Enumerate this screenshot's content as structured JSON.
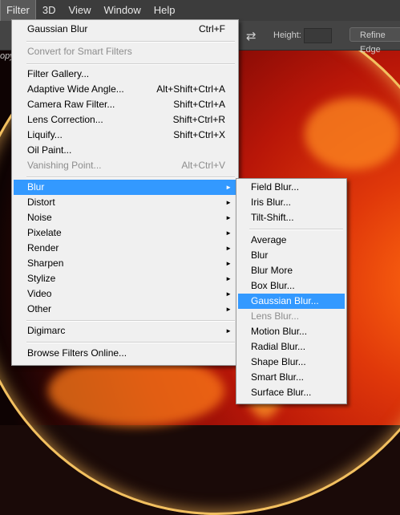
{
  "menubar": {
    "items": [
      {
        "label": "Filter",
        "active": true
      },
      {
        "label": "3D"
      },
      {
        "label": "View"
      },
      {
        "label": "Window"
      },
      {
        "label": "Help"
      }
    ]
  },
  "options_bar": {
    "height_label": "Height:",
    "refine_edge_label": "Refine Edge"
  },
  "doc_tab_fragment": "opy",
  "filter_menu": {
    "last_filter": {
      "label": "Gaussian Blur",
      "shortcut": "Ctrl+F"
    },
    "convert_smart": {
      "label": "Convert for Smart Filters"
    },
    "filter_gallery": {
      "label": "Filter Gallery..."
    },
    "adaptive_wide_angle": {
      "label": "Adaptive Wide Angle...",
      "shortcut": "Alt+Shift+Ctrl+A"
    },
    "camera_raw": {
      "label": "Camera Raw Filter...",
      "shortcut": "Shift+Ctrl+A"
    },
    "lens_correction": {
      "label": "Lens Correction...",
      "shortcut": "Shift+Ctrl+R"
    },
    "liquify": {
      "label": "Liquify...",
      "shortcut": "Shift+Ctrl+X"
    },
    "oil_paint": {
      "label": "Oil Paint..."
    },
    "vanishing_point": {
      "label": "Vanishing Point...",
      "shortcut": "Alt+Ctrl+V"
    },
    "blur": {
      "label": "Blur"
    },
    "distort": {
      "label": "Distort"
    },
    "noise": {
      "label": "Noise"
    },
    "pixelate": {
      "label": "Pixelate"
    },
    "render": {
      "label": "Render"
    },
    "sharpen": {
      "label": "Sharpen"
    },
    "stylize": {
      "label": "Stylize"
    },
    "video": {
      "label": "Video"
    },
    "other": {
      "label": "Other"
    },
    "digimarc": {
      "label": "Digimarc"
    },
    "browse_online": {
      "label": "Browse Filters Online..."
    }
  },
  "blur_menu": {
    "field_blur": "Field Blur...",
    "iris_blur": "Iris Blur...",
    "tilt_shift": "Tilt-Shift...",
    "average": "Average",
    "blur": "Blur",
    "blur_more": "Blur More",
    "box_blur": "Box Blur...",
    "gaussian_blur": "Gaussian Blur...",
    "lens_blur": "Lens Blur...",
    "motion_blur": "Motion Blur...",
    "radial_blur": "Radial Blur...",
    "shape_blur": "Shape Blur...",
    "smart_blur": "Smart Blur...",
    "surface_blur": "Surface Blur..."
  },
  "colors": {
    "menu_highlight": "#3399ff",
    "menubar_bg": "#3c3c3c",
    "menu_bg": "#f0f0f0"
  }
}
